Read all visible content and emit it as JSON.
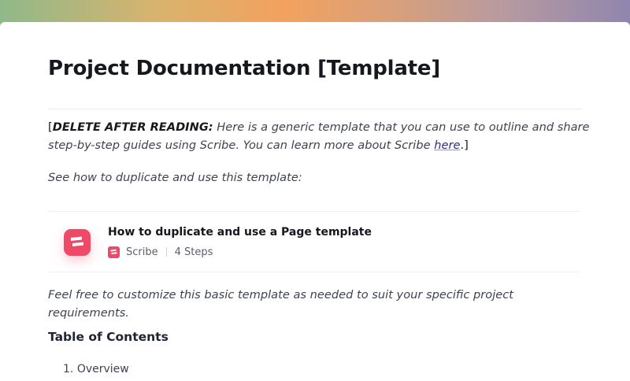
{
  "document": {
    "title": "Project Documentation [Template]",
    "intro": {
      "open_bracket": "[",
      "strong": "DELETE AFTER READING:",
      "text": " Here is a generic template that you can use to outline and share step-by-step guides using Scribe. You can learn more about Scribe ",
      "link_label": "here",
      "close": ".]"
    },
    "see_how": "See how to duplicate and use this template:",
    "embed": {
      "title": "How to duplicate and use a Page template",
      "source": "Scribe",
      "steps": "4 Steps",
      "icon": "scribe-logo-icon",
      "accent_color": "#ee4a67"
    },
    "customize_note": "Feel free to customize this basic template as needed to suit your specific project requirements.",
    "toc": {
      "heading": "Table of Contents",
      "items": [
        {
          "number": "1.",
          "label": "Overview"
        }
      ]
    }
  }
}
